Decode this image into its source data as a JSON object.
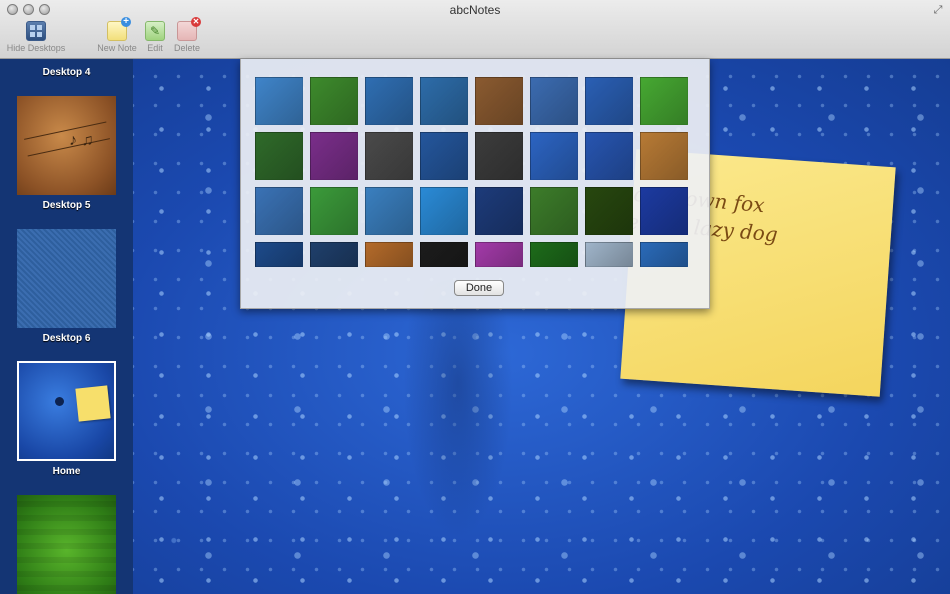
{
  "window": {
    "title": "abcNotes"
  },
  "toolbar": {
    "hide_desktops": "Hide Desktops",
    "new_note": "New Note",
    "edit": "Edit",
    "delete": "Delete"
  },
  "sidebar": {
    "items": [
      {
        "label": "Desktop 4"
      },
      {
        "label": "Desktop 5"
      },
      {
        "label": "Desktop 6"
      },
      {
        "label": "Home",
        "selected": true
      }
    ]
  },
  "note": {
    "line1": "quick brown fox",
    "line2": "s over the lazy dog",
    "color": "#f7df6b"
  },
  "picker": {
    "done_label": "Done",
    "wallpapers": [
      [
        "#3f84c9",
        "#3d8a2c",
        "#2f6eb2",
        "#2d6ca9",
        "#8a5a30",
        "#3b6bb0",
        "#2a5fb4",
        "#46a832"
      ],
      [
        "#2f6a2a",
        "#7a2e8a",
        "#4a4a4a",
        "#24569c",
        "#3c3c3c",
        "#2c64c2",
        "#2755b0",
        "#b77a35"
      ],
      [
        "#3a72b5",
        "#3b9a3a",
        "#3a7fbf",
        "#2a8ad6",
        "#1d3b7a",
        "#3c7c2a",
        "#27470f",
        "#1c3aa0"
      ],
      [
        "#1d4a8a",
        "#1f3f6b",
        "#b36a2a",
        "#1c1c1c",
        "#a23aa8",
        "#1d6b1a",
        "#9fb4c9",
        "#2a6ab8"
      ]
    ]
  },
  "colors": {
    "desktop_blue": "#1b49b0",
    "sidebar_bg": "#143574"
  }
}
